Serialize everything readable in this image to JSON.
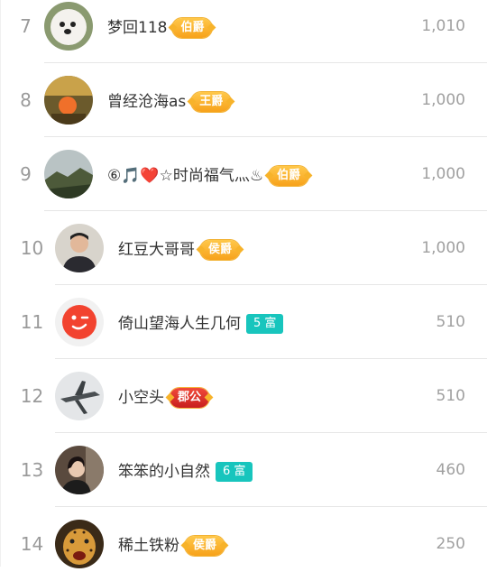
{
  "rows": [
    {
      "rank": "7",
      "name": "梦回118",
      "badge": "伯爵",
      "badge_type": "title",
      "score": "1,010"
    },
    {
      "rank": "8",
      "name": "曾经沧海as",
      "badge": "王爵",
      "badge_type": "title",
      "score": "1,000"
    },
    {
      "rank": "9",
      "name": "⑥🎵❤️☆时尚福气灬♨",
      "badge": "伯爵",
      "badge_type": "title",
      "score": "1,000"
    },
    {
      "rank": "10",
      "name": "红豆大哥哥",
      "badge": "侯爵",
      "badge_type": "title",
      "score": "1,000"
    },
    {
      "rank": "11",
      "name": "倚山望海人生几何",
      "badge": "5 富",
      "badge_type": "wealth",
      "score": "510"
    },
    {
      "rank": "12",
      "name": "小空头",
      "badge": "郡公",
      "badge_type": "title-red",
      "score": "510"
    },
    {
      "rank": "13",
      "name": "笨笨的小自然",
      "badge": "6 富",
      "badge_type": "wealth",
      "score": "460"
    },
    {
      "rank": "14",
      "name": "稀土铁粉",
      "badge": "侯爵",
      "badge_type": "title",
      "score": "250"
    }
  ],
  "colors": {
    "rank_text": "#9a9a9a",
    "name_text": "#333333",
    "score_text": "#a0a0a0",
    "title_badge": "#f7a21b",
    "title_badge_red": "#c81f1f",
    "wealth_badge": "#18c5bd",
    "divider": "#e6e6e6"
  },
  "avatars": [
    "white-dog-avatar",
    "orange-fruit-avatar",
    "mountain-landscape-avatar",
    "man-portrait-avatar",
    "red-smiley-avatar",
    "airplane-avatar",
    "woman-portrait-avatar",
    "leopard-avatar"
  ]
}
